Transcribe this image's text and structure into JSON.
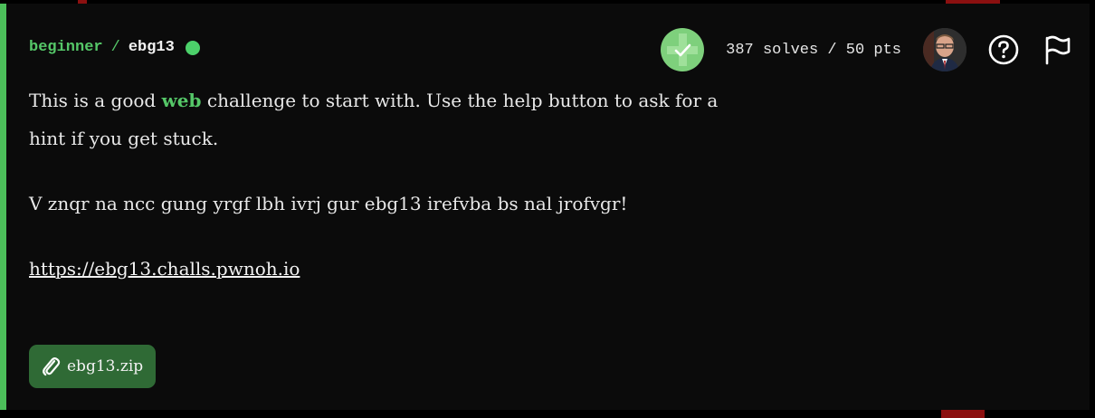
{
  "challenge": {
    "category": "beginner",
    "separator": "/",
    "name": "ebg13",
    "status": "solved",
    "stats": "387 solves / 50 pts"
  },
  "description": {
    "intro_before": "This is a good ",
    "intro_keyword": "web",
    "intro_after": " challenge to start with. Use the help button to ask for a hint if you get stuck.",
    "cipher_text": "V znqr na ncc gung yrgf lbh ivrj gur ebg13 irefvba bs nal jrofvgr!",
    "link": "https://ebg13.challs.pwnoh.io"
  },
  "attachment": {
    "filename": "ebg13.zip",
    "icon": "paperclip-icon"
  },
  "icons": {
    "status": "status-dot-icon",
    "solved": "solved-badge-icon",
    "help": "help-icon",
    "flag": "flag-icon"
  },
  "colors": {
    "accent": "#4cbf5a",
    "card_background": "#0b0b0b",
    "attachment_background": "#2f6a35",
    "text": "#e8e8e8"
  }
}
